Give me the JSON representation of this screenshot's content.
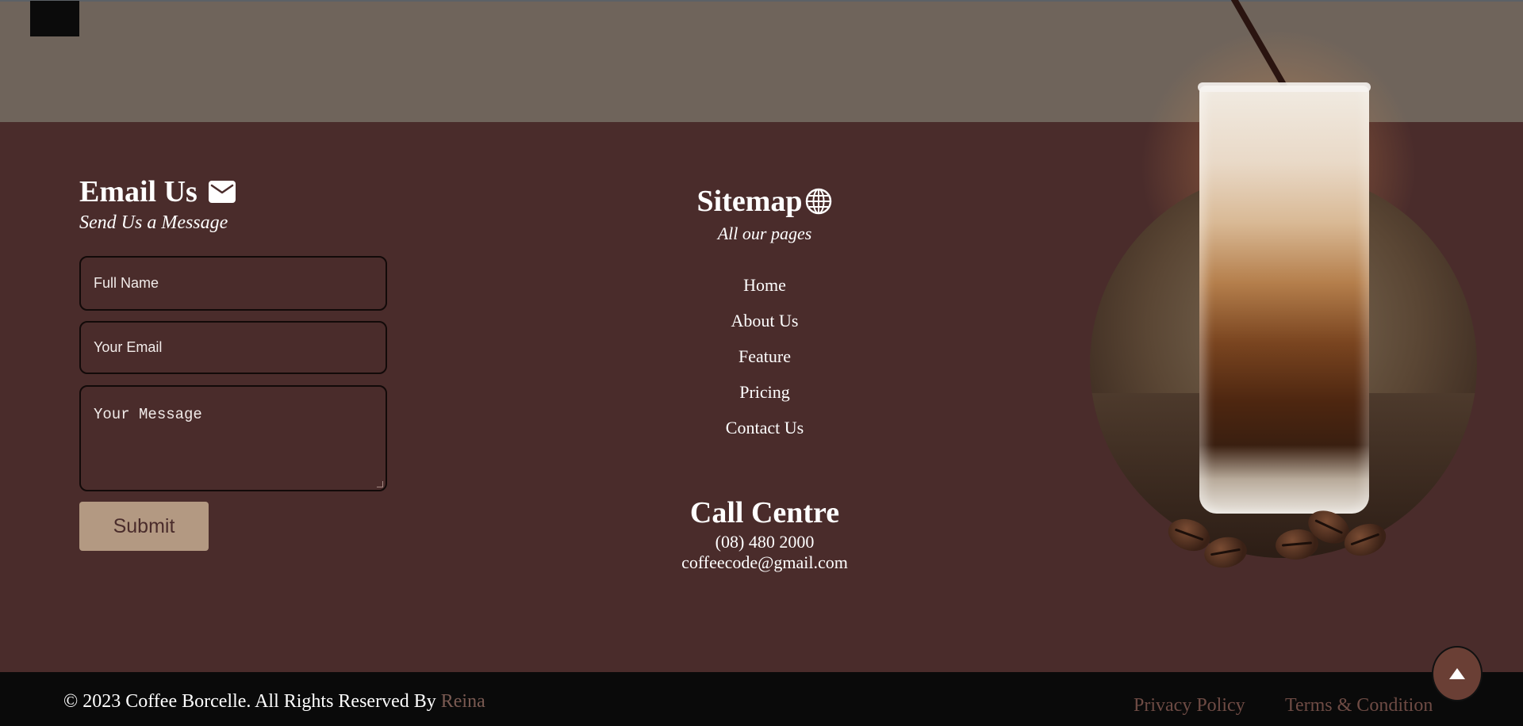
{
  "email": {
    "title": "Email Us",
    "subtitle": "Send Us a Message",
    "name_placeholder": "Full Name",
    "email_placeholder": "Your Email",
    "message_placeholder": "Your Message",
    "submit_label": "Submit"
  },
  "sitemap": {
    "title": "Sitemap",
    "subtitle": "All our pages",
    "items": [
      {
        "label": "Home"
      },
      {
        "label": "About Us"
      },
      {
        "label": "Feature"
      },
      {
        "label": "Pricing"
      },
      {
        "label": "Contact Us"
      }
    ]
  },
  "call": {
    "title": "Call Centre",
    "phone": "(08) 480 2000",
    "email": "coffeecode@gmail.com"
  },
  "footer": {
    "copyright": "© 2023 Coffee Borcelle. All Rights Reserved By ",
    "author": "Reina",
    "privacy": "Privacy Policy",
    "terms": "Terms & Condition"
  },
  "icons": {
    "email": "envelope-icon",
    "sitemap": "globe-icon",
    "scroll_top": "arrow-up-icon"
  },
  "colors": {
    "background": "#4a2c2b",
    "top_band": "#6f645b",
    "bottom_bar": "#0a0a0a",
    "submit": "#b39982",
    "accent_link": "#6e4b44"
  }
}
